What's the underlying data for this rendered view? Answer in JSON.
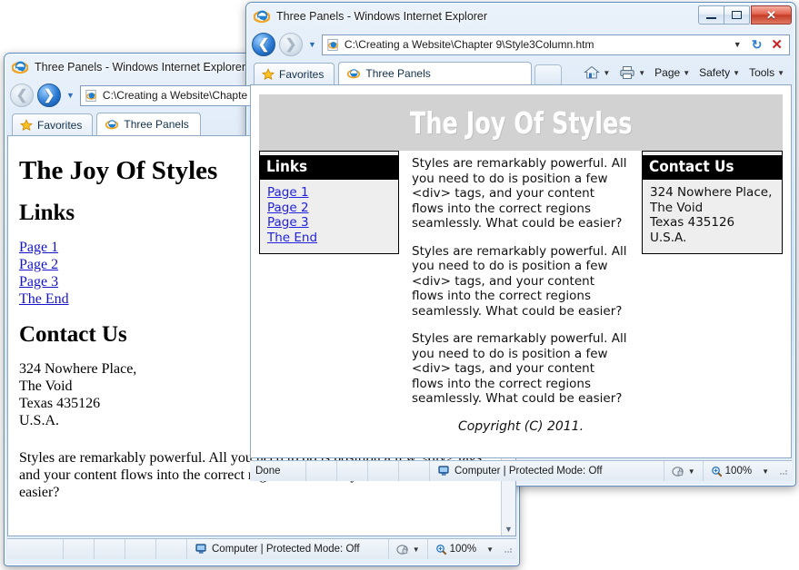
{
  "back_window": {
    "title": "Three Panels - Windows Internet Explorer",
    "address": "C:\\Creating a Website\\Chapte",
    "favorites_label": "Favorites",
    "tab_label": "Three Panels",
    "status": {
      "done": "",
      "zone": "Computer | Protected Mode: Off",
      "zoom": "100%"
    },
    "page": {
      "h1": "The Joy Of Styles",
      "links_heading": "Links",
      "links": [
        "Page 1",
        "Page 2",
        "Page 3",
        "The End"
      ],
      "contact_heading": "Contact Us",
      "address_lines": [
        "324 Nowhere Place,",
        "The Void",
        "Texas 435126",
        "U.S.A."
      ],
      "paragraph": "Styles are remarkably powerful. All you need to do is position a few <div> tags, and your content flows into the correct regions seamlessly. What could be easier?"
    }
  },
  "front_window": {
    "title": "Three Panels - Windows Internet Explorer",
    "address": "C:\\Creating a Website\\Chapter 9\\Style3Column.htm",
    "favorites_label": "Favorites",
    "tab_label": "Three Panels",
    "commands": [
      {
        "label": "",
        "icon": "home-icon"
      },
      {
        "label": "",
        "icon": "print-icon"
      },
      {
        "label": "Page",
        "icon": ""
      },
      {
        "label": "Safety",
        "icon": ""
      },
      {
        "label": "Tools",
        "icon": ""
      }
    ],
    "status": {
      "done": "Done",
      "zone": "Computer | Protected Mode: Off",
      "zoom": "100%"
    },
    "page": {
      "banner_title": "The Joy Of Styles",
      "links_heading": "Links",
      "links": [
        "Page 1",
        "Page 2",
        "Page 3",
        "The End"
      ],
      "contact_heading": "Contact Us",
      "address_lines": [
        "324 Nowhere Place,",
        "The Void",
        "Texas 435126",
        "U.S.A."
      ],
      "paragraphs": [
        "Styles are remarkably powerful. All you need to do is position a few <div> tags, and your content flows into the correct regions seamlessly. What could be easier?",
        "Styles are remarkably powerful. All you need to do is position a few <div> tags, and your content flows into the correct regions seamlessly. What could be easier?",
        "Styles are remarkably powerful. All you need to do is position a few <div> tags, and your content flows into the correct regions seamlessly. What could be easier?"
      ],
      "copyright": "Copyright (C) 2011."
    }
  },
  "colors": {
    "banner_bg": "#d2d2d2",
    "panel_header_bg": "#000000",
    "panel_bg": "#eeeeee",
    "link": "#2222dd",
    "close_button": "#c53c27"
  }
}
